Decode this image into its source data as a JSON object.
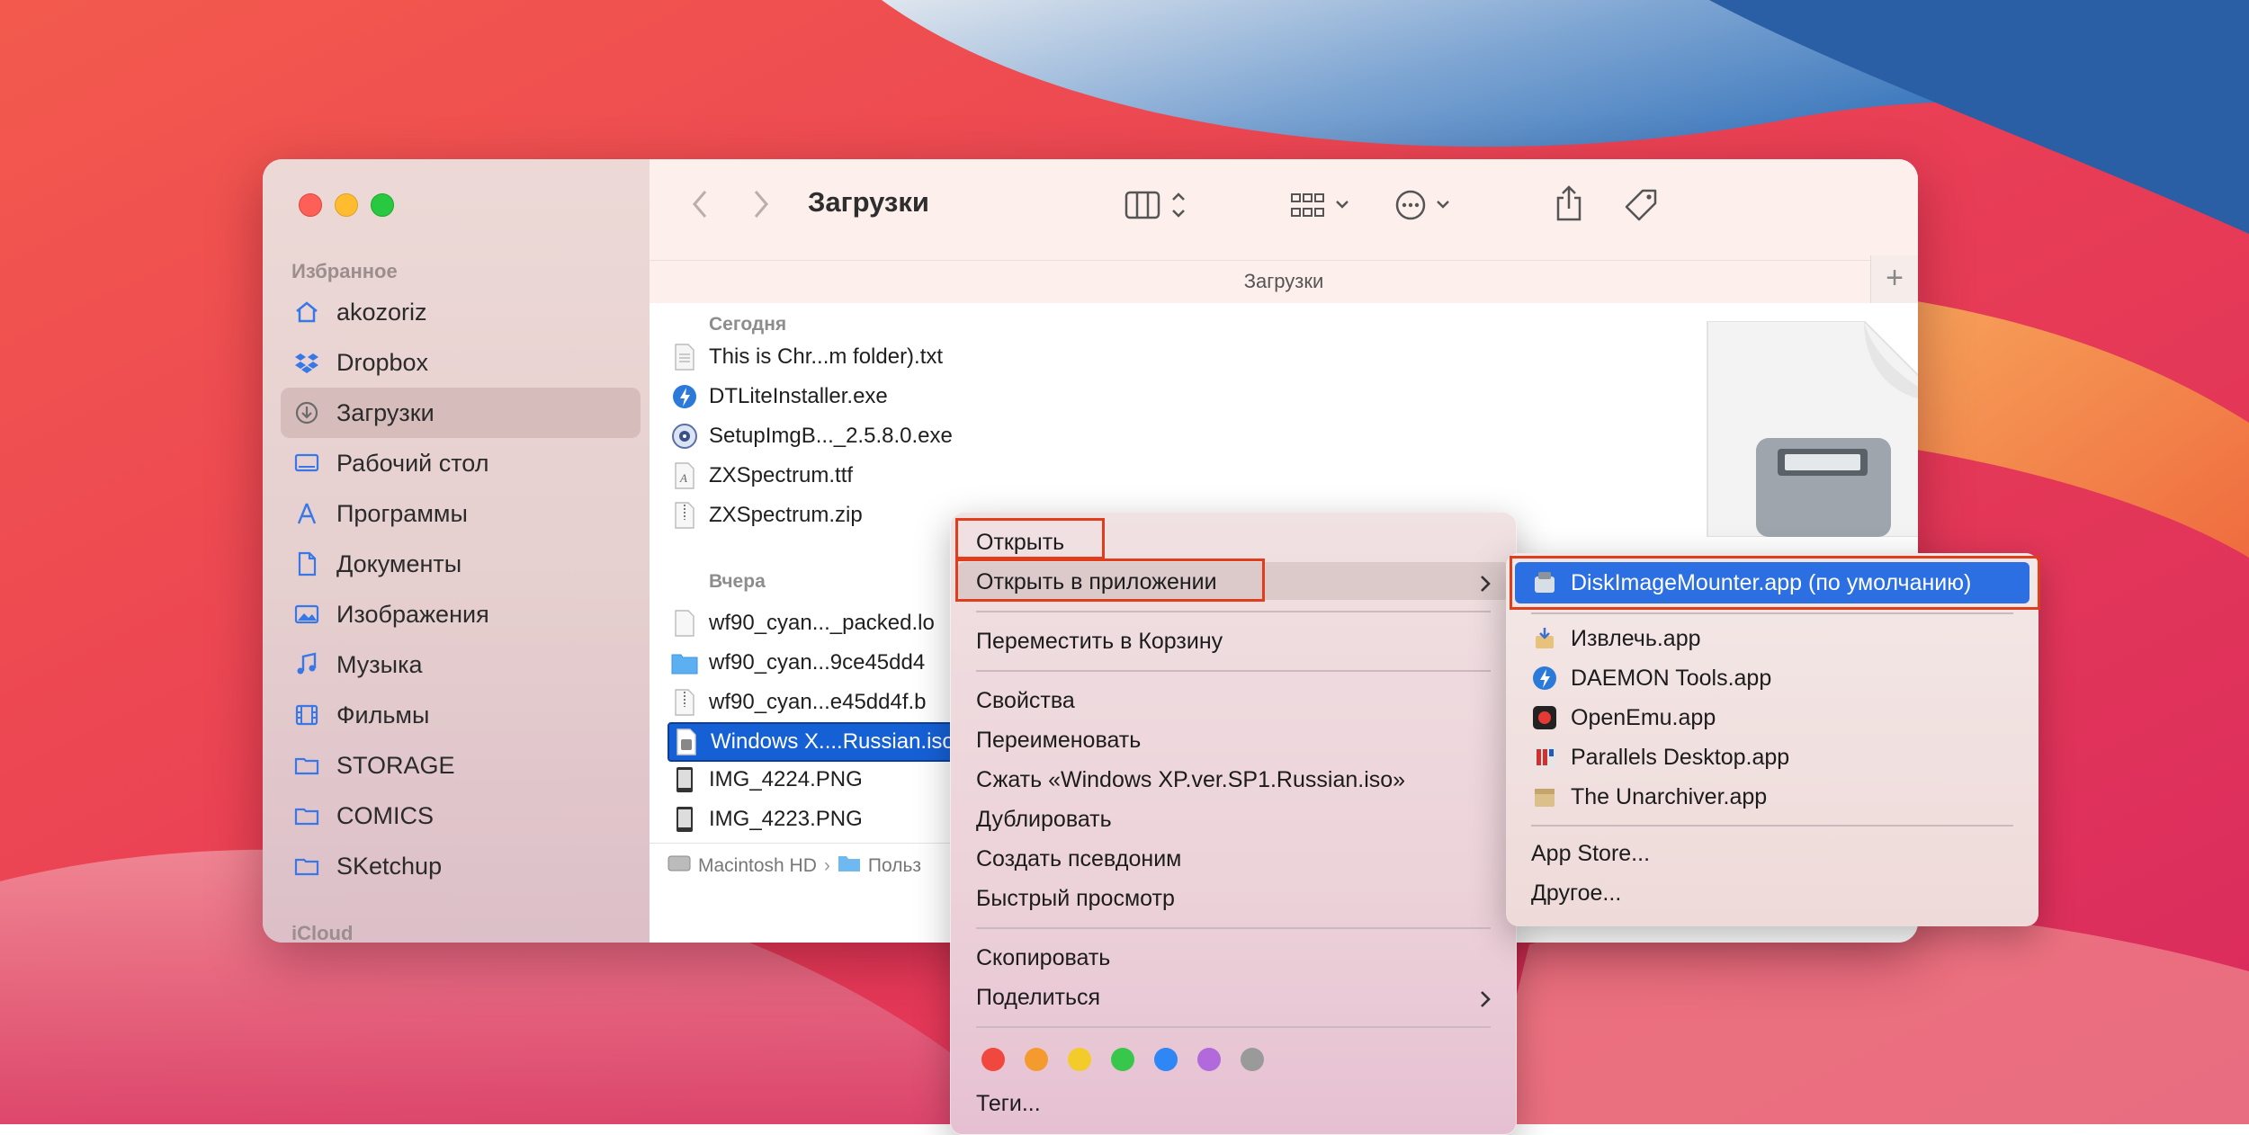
{
  "finder": {
    "title": "Загрузки",
    "path_title": "Загрузки",
    "sidebar": {
      "favorites_header": "Избранное",
      "icloud_header": "iCloud",
      "items": [
        {
          "label": "akozoriz",
          "icon": "home-icon"
        },
        {
          "label": "Dropbox",
          "icon": "dropbox-icon"
        },
        {
          "label": "Загрузки",
          "icon": "download-icon",
          "selected": true
        },
        {
          "label": "Рабочий стол",
          "icon": "desktop-icon"
        },
        {
          "label": "Программы",
          "icon": "applications-icon"
        },
        {
          "label": "Документы",
          "icon": "document-icon"
        },
        {
          "label": "Изображения",
          "icon": "photo-icon"
        },
        {
          "label": "Музыка",
          "icon": "music-icon"
        },
        {
          "label": "Фильмы",
          "icon": "film-icon"
        },
        {
          "label": "STORAGE",
          "icon": "folder-icon"
        },
        {
          "label": "COMICS",
          "icon": "folder-icon"
        },
        {
          "label": "SKetchup",
          "icon": "folder-icon"
        }
      ]
    },
    "list": {
      "groups": [
        {
          "label": "Сегодня",
          "files": [
            "This is Chr...m folder).txt",
            "DTLiteInstaller.exe",
            "SetupImgB..._2.5.8.0.exe",
            "ZXSpectrum.ttf",
            "ZXSpectrum.zip"
          ]
        },
        {
          "label": "Вчера",
          "files": [
            "wf90_cyan..._packed.lo",
            "wf90_cyan...9ce45dd4",
            "wf90_cyan...e45dd4f.b",
            "Windows X....Russian.iso",
            "IMG_4224.PNG",
            "IMG_4223.PNG"
          ]
        }
      ],
      "selected_file": "Windows X....Russian.iso"
    },
    "breadcrumbs": [
      "Macintosh HD",
      "Польз"
    ]
  },
  "context_menu": {
    "open": "Открыть",
    "open_with": "Открыть в приложении",
    "move_to_trash": "Переместить в Корзину",
    "get_info": "Свойства",
    "rename": "Переименовать",
    "compress": "Сжать «Windows XP.ver.SP1.Russian.iso»",
    "duplicate": "Дублировать",
    "make_alias": "Создать псевдоним",
    "quick_look": "Быстрый просмотр",
    "copy": "Скопировать",
    "share": "Поделиться",
    "tags": "Теги...",
    "tag_colors": [
      "#f0473e",
      "#f59a2e",
      "#f3cb2a",
      "#37c84b",
      "#2f86f5",
      "#b269dc",
      "#9a9a9a"
    ]
  },
  "open_with_submenu": {
    "default_app": "DiskImageMounter.app (по умолчанию)",
    "apps": [
      "Извлечь.app",
      "DAEMON Tools.app",
      "OpenEmu.app",
      "Parallels Desktop.app",
      "The Unarchiver.app"
    ],
    "app_store": "App Store...",
    "other": "Другое..."
  },
  "colors": {
    "selection_blue": "#1660d6",
    "annotation_red": "#e03d1c"
  }
}
